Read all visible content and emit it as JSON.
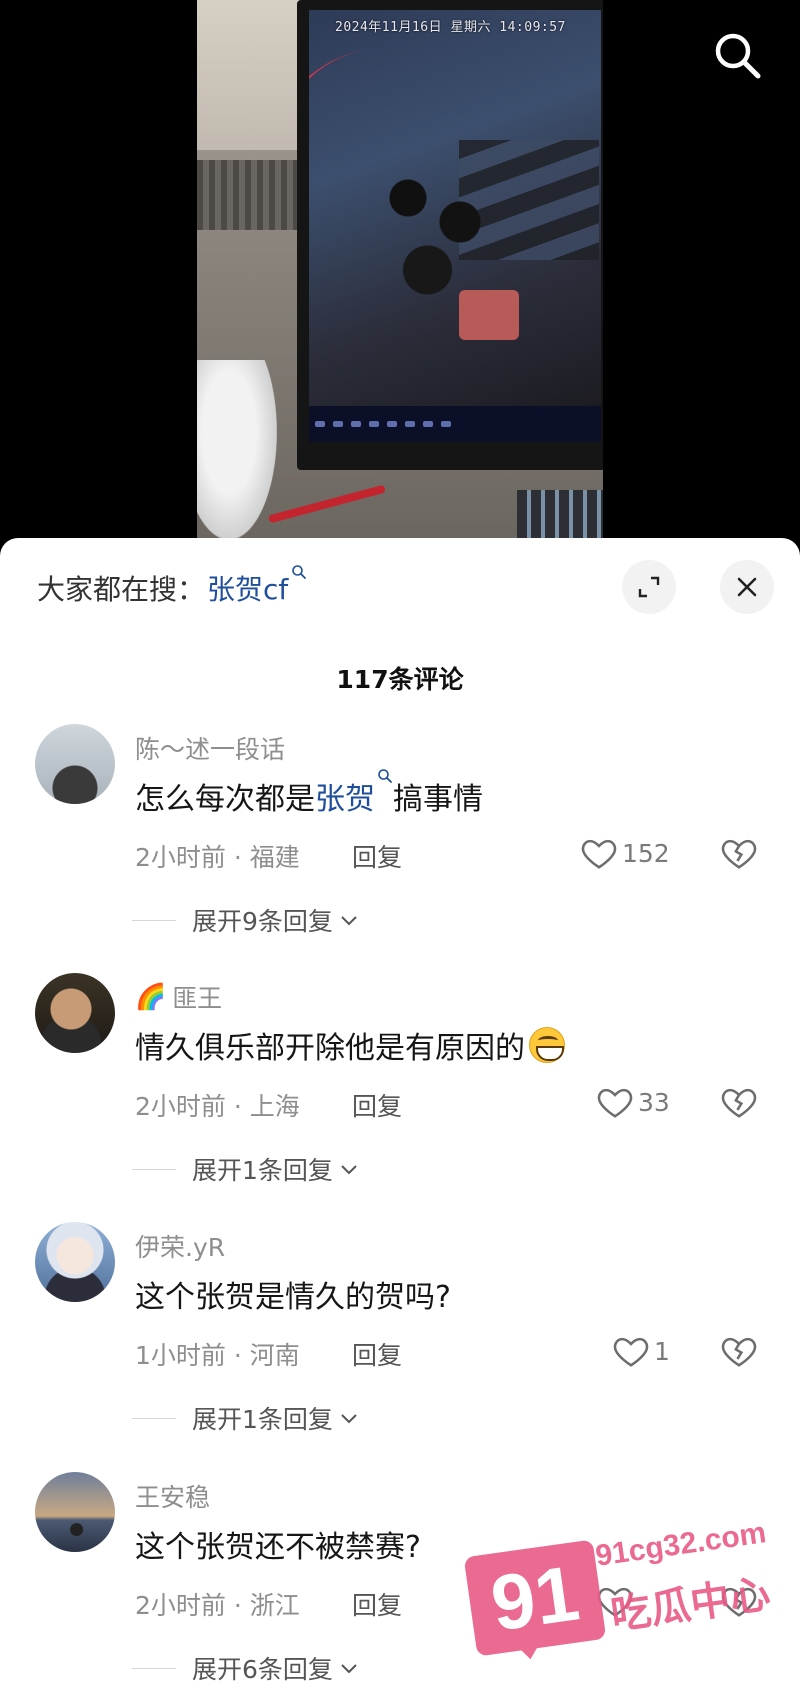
{
  "video": {
    "cctv_timestamp": "2024年11月16日 星期六 14:09:57"
  },
  "sheet": {
    "trending_prefix": "大家都在搜：",
    "trending_keyword": "张贺cf",
    "comment_count_title": "117条评论"
  },
  "comments": [
    {
      "user": "陈～述一段话",
      "text_before": "怎么每次都是",
      "keyword": "张贺",
      "text_after": "搞事情",
      "meta": "2小时前 · 福建",
      "reply_label": "回复",
      "likes": "152",
      "expand_label": "展开9条回复"
    },
    {
      "user_badge": "🌈",
      "user": "匪王",
      "text": "情久俱乐部开除他是有原因的",
      "emoji": "grinning-emoji",
      "meta": "2小时前 · 上海",
      "reply_label": "回复",
      "likes": "33",
      "expand_label": "展开1条回复"
    },
    {
      "user": "伊荣.yR",
      "text": "这个张贺是情久的贺吗?",
      "meta": "1小时前 · 河南",
      "reply_label": "回复",
      "likes": "1",
      "expand_label": "展开1条回复"
    },
    {
      "user": "王安稳",
      "text": "这个张贺还不被禁赛?",
      "meta": "2小时前 · 浙江",
      "reply_label": "回复",
      "likes": "",
      "expand_label": "展开6条回复"
    }
  ],
  "watermark": {
    "number": "91",
    "domain": "91cg32.com",
    "name": "吃瓜中心"
  },
  "colors": {
    "keyword_blue": "#1f4f9c",
    "watermark_pink": "#e95a86"
  }
}
